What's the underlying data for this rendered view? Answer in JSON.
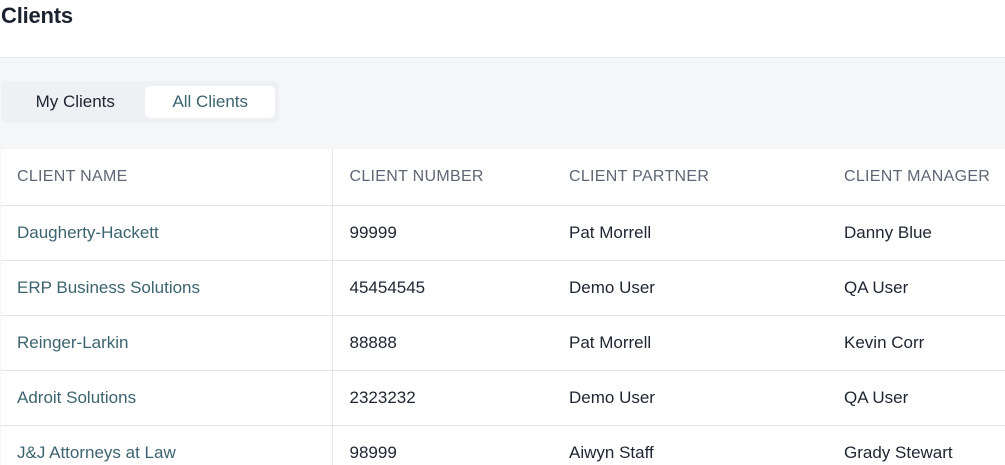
{
  "header": {
    "title": "Clients"
  },
  "tabs": [
    {
      "label": "My Clients",
      "active": false
    },
    {
      "label": "All Clients",
      "active": true
    }
  ],
  "table": {
    "columns": [
      "CLIENT NAME",
      "CLIENT NUMBER",
      "CLIENT PARTNER",
      "CLIENT MANAGER"
    ],
    "rows": [
      {
        "name": "Daugherty-Hackett",
        "number": "99999",
        "partner": "Pat Morrell",
        "manager": "Danny Blue"
      },
      {
        "name": "ERP Business Solutions",
        "number": "45454545",
        "partner": "Demo User",
        "manager": "QA User"
      },
      {
        "name": "Reinger-Larkin",
        "number": "88888",
        "partner": "Pat Morrell",
        "manager": "Kevin Corr"
      },
      {
        "name": "Adroit Solutions",
        "number": "2323232",
        "partner": "Demo User",
        "manager": "QA User"
      },
      {
        "name": "J&J Attorneys at Law",
        "number": "98999",
        "partner": "Aiwyn Staff",
        "manager": "Grady Stewart"
      }
    ]
  },
  "colors": {
    "accent": "#3c6470",
    "text": "#1e2532",
    "muted": "#5e6675",
    "background": "#f5f6f8"
  }
}
